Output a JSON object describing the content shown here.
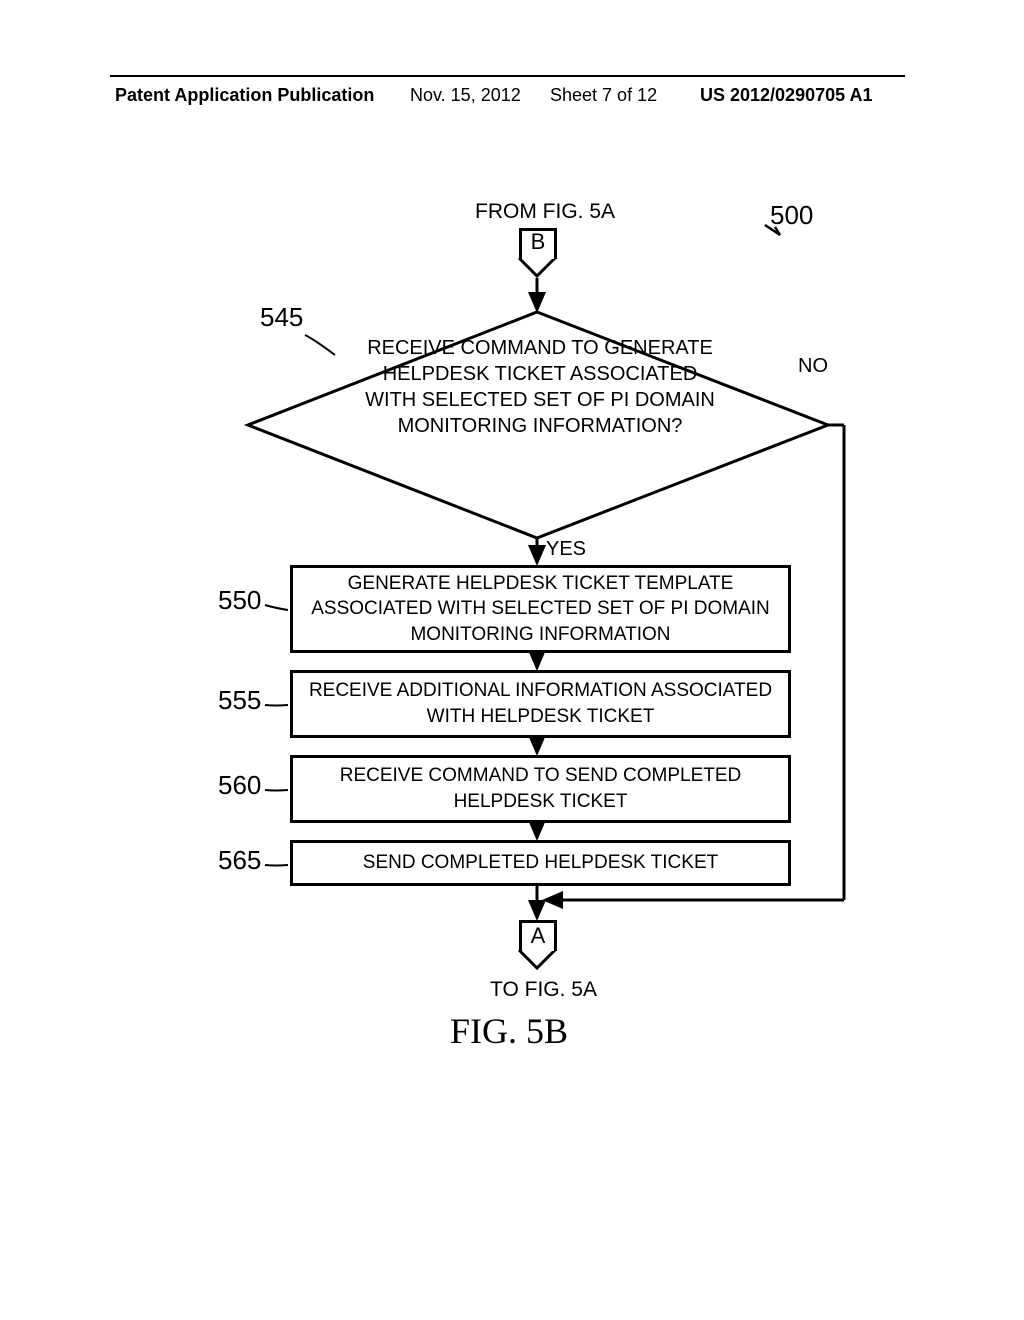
{
  "header": {
    "left": "Patent Application Publication",
    "date": "Nov. 15, 2012",
    "sheet": "Sheet 7 of 12",
    "pub_no": "US 2012/0290705 A1"
  },
  "figure": {
    "title": "FIG. 5B",
    "ref_main": "500",
    "from_label": "FROM FIG. 5A",
    "to_label": "TO FIG. 5A",
    "connector_top": "B",
    "connector_bottom": "A",
    "decision": {
      "ref": "545",
      "text": "RECEIVE COMMAND TO GENERATE HELPDESK TICKET ASSOCIATED WITH SELECTED SET OF PI DOMAIN MONITORING INFORMATION?",
      "yes": "YES",
      "no": "NO"
    },
    "steps": [
      {
        "ref": "550",
        "text": "GENERATE HELPDESK TICKET TEMPLATE ASSOCIATED WITH SELECTED SET OF PI DOMAIN MONITORING INFORMATION"
      },
      {
        "ref": "555",
        "text": "RECEIVE ADDITIONAL INFORMATION ASSOCIATED WITH HELPDESK TICKET"
      },
      {
        "ref": "560",
        "text": "RECEIVE COMMAND TO SEND COMPLETED HELPDESK TICKET"
      },
      {
        "ref": "565",
        "text": "SEND COMPLETED HELPDESK TICKET"
      }
    ]
  }
}
